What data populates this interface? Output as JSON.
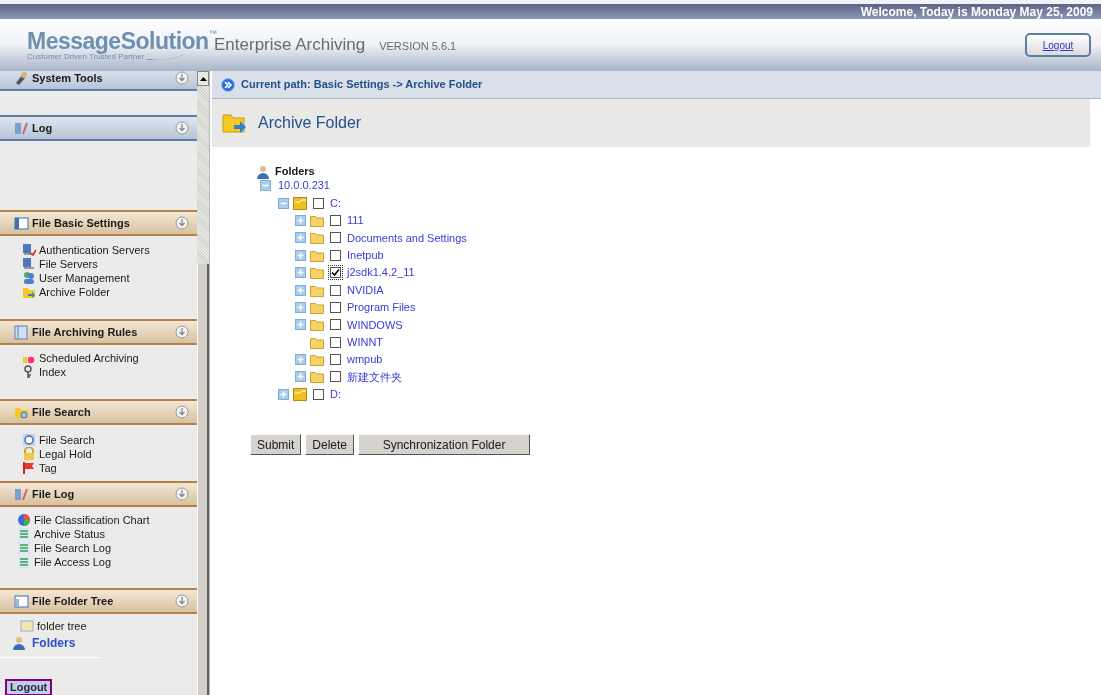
{
  "top_bar": {
    "welcome": "Welcome, Today is Monday May 25, 2009"
  },
  "header": {
    "logo": "MessageSolution",
    "logo_mark": "™",
    "tagline": "Customer Driven Trusted Partner",
    "product": "Enterprise Archiving",
    "version": "VERSION 5.6.1",
    "logout": "Logout"
  },
  "sidebar": {
    "sections": [
      {
        "title": "System Tools",
        "kind": "system"
      },
      {
        "title": "Log",
        "kind": "system"
      },
      {
        "title": "File Basic Settings",
        "kind": "file",
        "items": [
          {
            "label": "Authentication Servers",
            "kind": "item"
          },
          {
            "label": "File Servers",
            "kind": "item"
          },
          {
            "label": "User Management",
            "kind": "item"
          },
          {
            "label": "Archive Folder",
            "kind": "item"
          }
        ]
      },
      {
        "title": "File Archiving Rules",
        "kind": "file",
        "items": [
          {
            "label": "Scheduled Archiving",
            "kind": "item"
          },
          {
            "label": "Index",
            "kind": "item"
          }
        ]
      },
      {
        "title": "File Search",
        "kind": "file",
        "items": [
          {
            "label": "File Search",
            "kind": "item"
          },
          {
            "label": "Legal Hold",
            "kind": "item"
          },
          {
            "label": "Tag",
            "kind": "item"
          }
        ]
      },
      {
        "title": "File Log",
        "kind": "file",
        "items": [
          {
            "label": "File Classification Chart",
            "kind": "item"
          },
          {
            "label": "Archive Status",
            "kind": "item"
          },
          {
            "label": "File Search Log",
            "kind": "item"
          },
          {
            "label": "File Access Log",
            "kind": "item"
          }
        ]
      },
      {
        "title": "File Folder Tree",
        "kind": "file",
        "items": [
          {
            "label": "folder tree",
            "kind": "item"
          },
          {
            "label": "Folders",
            "kind": "link"
          }
        ]
      }
    ],
    "logout": "Logout"
  },
  "breadcrumb": "Current path: Basic Settings -> Archive Folder",
  "page_title": "Archive Folder",
  "tree": {
    "label": "Folders",
    "children": [
      {
        "label": "10.0.0.231",
        "kind": "host",
        "expandable": true,
        "expanded": true,
        "children": [
          {
            "label": "C:",
            "kind": "drive",
            "expandable": true,
            "expanded": true,
            "checked": false,
            "focused": false,
            "children": [
              {
                "label": "111",
                "kind": "folder",
                "expandable": true,
                "expanded": false,
                "checked": false,
                "focused": false
              },
              {
                "label": "Documents and Settings",
                "kind": "folder",
                "expandable": true,
                "expanded": false,
                "checked": false,
                "focused": false
              },
              {
                "label": "Inetpub",
                "kind": "folder",
                "expandable": true,
                "expanded": false,
                "checked": false,
                "focused": false
              },
              {
                "label": "j2sdk1.4.2_11",
                "kind": "folder",
                "expandable": true,
                "expanded": false,
                "checked": true,
                "focused": true
              },
              {
                "label": "NVIDIA",
                "kind": "folder",
                "expandable": true,
                "expanded": false,
                "checked": false,
                "focused": false
              },
              {
                "label": "Program Files",
                "kind": "folder",
                "expandable": true,
                "expanded": false,
                "checked": false,
                "focused": false
              },
              {
                "label": "WINDOWS",
                "kind": "folder",
                "expandable": true,
                "expanded": false,
                "checked": false,
                "focused": false
              },
              {
                "label": "WINNT",
                "kind": "folder",
                "expandable": false,
                "expanded": false,
                "checked": false,
                "focused": false
              },
              {
                "label": "wmpub",
                "kind": "folder",
                "expandable": true,
                "expanded": false,
                "checked": false,
                "focused": false
              },
              {
                "label": "新建文件夹",
                "kind": "folder",
                "expandable": true,
                "expanded": false,
                "checked": false,
                "focused": false
              }
            ]
          },
          {
            "label": "D:",
            "kind": "drive",
            "expandable": true,
            "expanded": false,
            "checked": false,
            "focused": false
          }
        ]
      }
    ]
  },
  "buttons": [
    "Submit",
    "Delete",
    "Synchronization Folder"
  ]
}
